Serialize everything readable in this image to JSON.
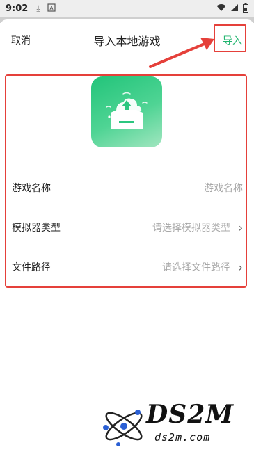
{
  "status_bar": {
    "time": "9:02",
    "icons": [
      "download-icon",
      "font-icon"
    ],
    "right_icons": [
      "wifi-icon",
      "signal-icon",
      "battery-icon"
    ]
  },
  "header": {
    "cancel_label": "取消",
    "title": "导入本地游戏",
    "import_label": "导入"
  },
  "form": {
    "rows": [
      {
        "label": "游戏名称",
        "value": "游戏名称",
        "has_chevron": false
      },
      {
        "label": "模拟器类型",
        "value": "请选择模拟器类型",
        "has_chevron": true
      },
      {
        "label": "文件路径",
        "value": "请选择文件路径",
        "has_chevron": true
      }
    ]
  },
  "watermark": {
    "logo": "DS2M",
    "url": "ds2m.com"
  },
  "colors": {
    "accent": "#20b46e",
    "highlight": "#e5403a",
    "placeholder": "#a8a8a8"
  }
}
